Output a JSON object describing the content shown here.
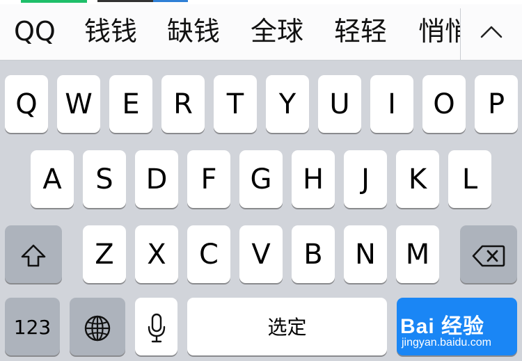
{
  "candidates": [
    "QQ",
    "钱钱",
    "缺钱",
    "全球",
    "轻轻",
    "悄悄"
  ],
  "keyboard": {
    "row1": [
      "Q",
      "W",
      "E",
      "R",
      "T",
      "Y",
      "U",
      "I",
      "O",
      "P"
    ],
    "row2": [
      "A",
      "S",
      "D",
      "F",
      "G",
      "H",
      "J",
      "K",
      "L"
    ],
    "row3": [
      "Z",
      "X",
      "C",
      "V",
      "B",
      "N",
      "M"
    ],
    "numbers_label": "123",
    "space_label": "选定"
  },
  "icons": {
    "expand": "chevron-up-icon",
    "shift": "shift-arrow-icon",
    "delete": "backspace-icon",
    "globe": "globe-icon",
    "mic": "microphone-icon"
  },
  "colors": {
    "keyboard_bg": "#d1d4da",
    "key_bg": "#ffffff",
    "dark_key_bg": "#adb3bc",
    "return_key_bg": "#1a86f5"
  },
  "watermark": {
    "main": "Bai 经验",
    "sub": "jingyan.baidu.com"
  }
}
